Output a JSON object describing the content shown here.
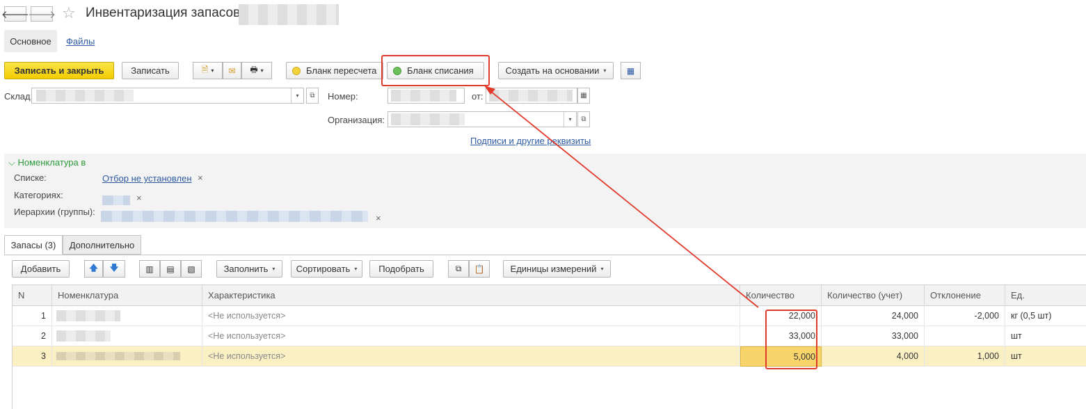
{
  "header": {
    "back_icon": "arrow-left-icon",
    "forward_icon": "arrow-right-icon",
    "star_icon": "star-icon",
    "title": "Инвентаризация запасов"
  },
  "section_tabs": {
    "main": "Основное",
    "files": "Файлы"
  },
  "toolbar": {
    "save_close": "Записать и закрыть",
    "save": "Записать",
    "recount_form": "Бланк пересчета",
    "writeoff_form": "Бланк списания",
    "create_based": "Создать на основании",
    "colors": {
      "yellow_dot": "#f5d33c",
      "green_dot": "#6cc05a",
      "primary": "#f5d200",
      "highlight": "#e03a2b"
    }
  },
  "form": {
    "warehouse_label": "Склад:",
    "number_label": "Номер:",
    "date_label": "от:",
    "org_label": "Организация:",
    "signatures_link": "Подписи и другие реквизиты"
  },
  "filter": {
    "group_title": "Номенклатура в",
    "lists_label": "Списке:",
    "lists_value": "Отбор не установлен",
    "categories_label": "Категориях:",
    "hierarchy_label": "Иерархии (группы):",
    "clear_symbol": "×"
  },
  "tabs": {
    "stocks": "Запасы (3)",
    "additional": "Дополнительно"
  },
  "table_toolbar": {
    "add": "Добавить",
    "fill": "Заполнить",
    "sort": "Сортировать",
    "pick": "Подобрать",
    "units": "Единицы измерений"
  },
  "table": {
    "columns": [
      "N",
      "Номенклатура",
      "Характеристика",
      "Количество",
      "Количество (учет)",
      "Отклонение",
      "Ед."
    ],
    "rows": [
      {
        "n": "1",
        "char": "<Не используется>",
        "qty": "22,000",
        "qty_acc": "24,000",
        "dev": "-2,000",
        "unit": "кг (0,5 шт)"
      },
      {
        "n": "2",
        "char": "<Не используется>",
        "qty": "33,000",
        "qty_acc": "33,000",
        "dev": "",
        "unit": "шт"
      },
      {
        "n": "3",
        "char": "<Не используется>",
        "qty": "5,000",
        "qty_acc": "4,000",
        "dev": "1,000",
        "unit": "шт"
      }
    ]
  }
}
